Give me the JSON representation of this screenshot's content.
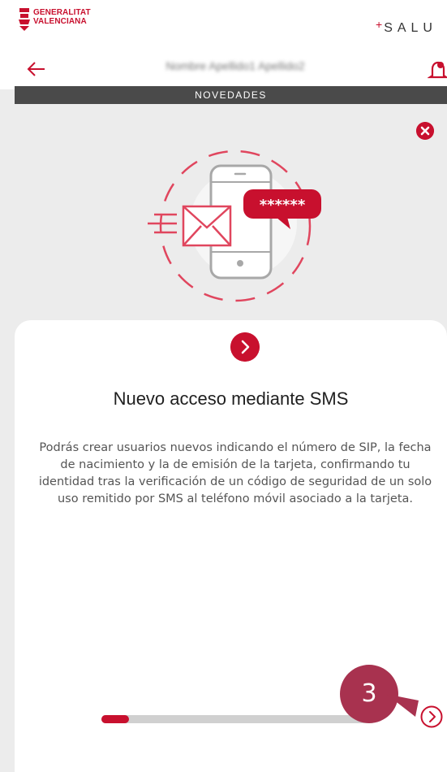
{
  "brand": {
    "logo_line1": "GENERALITAT",
    "logo_line2": "VALENCIANA",
    "app_plus": "+",
    "app_name": "SALU"
  },
  "nav": {
    "back_icon": "arrow-left-icon",
    "user_name": "Nombre Apellido1 Apellido2",
    "bell_icon": "bell-icon"
  },
  "news": {
    "label": "NOVEDADES"
  },
  "slide": {
    "title": "Nuevo acceso mediante SMS",
    "body": "Podrás crear usuarios nuevos indicando el número de SIP, la fecha de nacimiento y la de emisión de la tarjeta, confirmando tu identidad tras la verificación de un código de seguridad de un solo uso remitido por SMS al teléfono móvil asociado a la tarjeta.",
    "password_mask": "******"
  },
  "progress": {
    "fraction": 0.1
  },
  "annotation": {
    "step": "3"
  },
  "colors": {
    "accent": "#c8102e",
    "annotation": "#a8324f"
  }
}
